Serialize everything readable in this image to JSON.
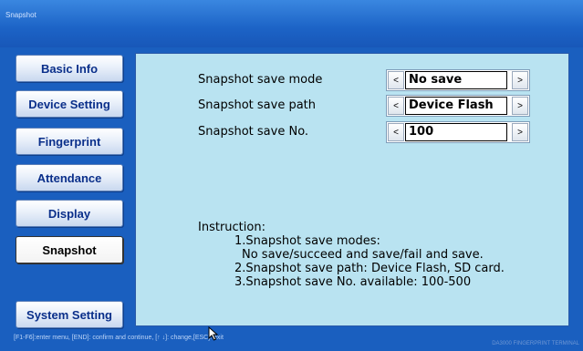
{
  "window": {
    "title": "Snapshot"
  },
  "menu": {
    "items": [
      {
        "label": "Basic Info"
      },
      {
        "label": "Device Setting"
      },
      {
        "label": "Fingerprint"
      },
      {
        "label": "Attendance"
      },
      {
        "label": "Display"
      },
      {
        "label": "Snapshot",
        "active": true
      },
      {
        "label": "System Setting"
      }
    ]
  },
  "settings": [
    {
      "label": "Snapshot save mode",
      "value": "No save",
      "left": "<",
      "right": ">"
    },
    {
      "label": "Snapshot save path",
      "value": "Device Flash",
      "left": "<",
      "right": ">"
    },
    {
      "label": "Snapshot save No.",
      "value": "100",
      "left": "<",
      "right": ">"
    }
  ],
  "instruction": {
    "heading": "Instruction:",
    "lines": [
      "1.Snapshot save modes:",
      "No save/succeed and save/fail and save.",
      "2.Snapshot save path: Device Flash, SD card.",
      "3.Snapshot save No. available: 100-500"
    ]
  },
  "status": {
    "hint": "[F1-F6]:enter menu, [END]: confirm and continue, [↑ ↓]: change,[ESC]: exit",
    "brand": "DA3000 FINGERPRINT TERMINAL"
  },
  "colors": {
    "background": "#1a5fbf",
    "panel": "#b9e3f1",
    "menu_text": "#0a2f8a"
  }
}
